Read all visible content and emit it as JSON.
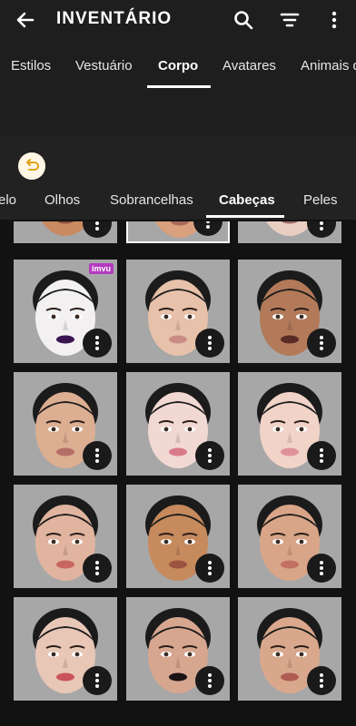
{
  "header": {
    "title": "INVENTÁRIO",
    "back_icon": "arrow-left-icon",
    "search_icon": "search-icon",
    "filter_icon": "filter-icon",
    "menu_icon": "more-vertical-icon"
  },
  "primary_tabs": [
    {
      "label": "Estilos"
    },
    {
      "label": "Vestuário"
    },
    {
      "label": "Corpo",
      "active": true
    },
    {
      "label": "Avatares"
    },
    {
      "label": "Animais d"
    }
  ],
  "secondary_tabs": [
    {
      "label": "elo"
    },
    {
      "label": "Olhos"
    },
    {
      "label": "Sobrancelhas"
    },
    {
      "label": "Cabeças",
      "active": true
    },
    {
      "label": "Peles"
    }
  ],
  "undo_icon": "undo-icon",
  "grid": {
    "badge": "imvu",
    "items": [
      {
        "skin": "#c98a62",
        "lips": "#8b4b3c",
        "partial": true
      },
      {
        "skin": "#d8a07c",
        "lips": "#a86a5a",
        "partial": true,
        "selected": true
      },
      {
        "skin": "#e8cfc2",
        "lips": "#a06b6b",
        "partial": true
      },
      {
        "skin": "#f3f0f2",
        "lips": "#3b1452",
        "badge": true
      },
      {
        "skin": "#e7c1a9",
        "lips": "#c98d86"
      },
      {
        "skin": "#b27a59",
        "lips": "#5a2b24"
      },
      {
        "skin": "#dcae92",
        "lips": "#b56e66"
      },
      {
        "skin": "#f2d8d3",
        "lips": "#d97a8a"
      },
      {
        "skin": "#f1d3c7",
        "lips": "#e0909a"
      },
      {
        "skin": "#e0b49e",
        "lips": "#c8665f"
      },
      {
        "skin": "#c68a5d",
        "lips": "#9b5340"
      },
      {
        "skin": "#d9a588",
        "lips": "#c26f64"
      },
      {
        "skin": "#e8c7b6",
        "lips": "#c9545c"
      },
      {
        "skin": "#d7a68f",
        "lips": "#1a1214"
      },
      {
        "skin": "#d9a88c",
        "lips": "#b05b54"
      }
    ]
  }
}
